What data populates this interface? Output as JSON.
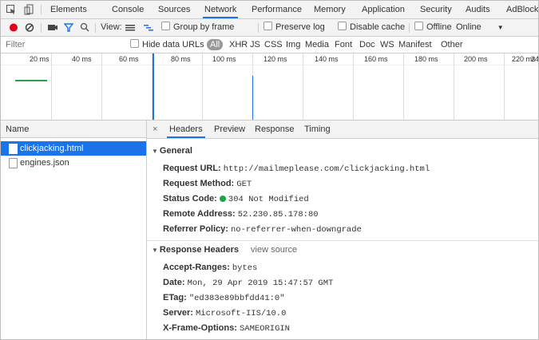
{
  "tabs": [
    "Elements",
    "Console",
    "Sources",
    "Network",
    "Performance",
    "Memory",
    "Application",
    "Security",
    "Audits",
    "AdBlock"
  ],
  "active_tab": "Network",
  "toolbar": {
    "view_label": "View:",
    "group_by_frame": "Group by frame",
    "preserve_log": "Preserve log",
    "disable_cache": "Disable cache",
    "offline": "Offline",
    "throttle_value": "Online"
  },
  "filter": {
    "placeholder": "Filter",
    "hide_data_urls": "Hide data URLs",
    "types": [
      "All",
      "XHR",
      "JS",
      "CSS",
      "Img",
      "Media",
      "Font",
      "Doc",
      "WS",
      "Manifest",
      "Other"
    ]
  },
  "timeline": {
    "ticks": [
      "20 ms",
      "40 ms",
      "60 ms",
      "80 ms",
      "100 ms",
      "120 ms",
      "140 ms",
      "160 ms",
      "180 ms",
      "200 ms",
      "220 ms",
      "24"
    ]
  },
  "requests": {
    "header": "Name",
    "items": [
      "clickjacking.html",
      "engines.json"
    ]
  },
  "detail": {
    "close": "×",
    "tabs": [
      "Headers",
      "Preview",
      "Response",
      "Timing"
    ],
    "general": {
      "title": "General",
      "request_url_label": "Request URL:",
      "request_url": "http://mailmeplease.com/clickjacking.html",
      "request_method_label": "Request Method:",
      "request_method": "GET",
      "status_code_label": "Status Code:",
      "status_code": "304 Not Modified",
      "remote_address_label": "Remote Address:",
      "remote_address": "52.230.85.178:80",
      "referrer_policy_label": "Referrer Policy:",
      "referrer_policy": "no-referrer-when-downgrade"
    },
    "response_headers": {
      "title": "Response Headers",
      "view_source": "view source",
      "accept_ranges_label": "Accept-Ranges:",
      "accept_ranges": "bytes",
      "date_label": "Date:",
      "date": "Mon, 29 Apr 2019 15:47:57 GMT",
      "etag_label": "ETag:",
      "etag": "\"ed383e89bbfdd41:0\"",
      "server_label": "Server:",
      "server": "Microsoft-IIS/10.0",
      "xfo_label": "X-Frame-Options:",
      "xfo": "SAMEORIGIN"
    }
  },
  "colors": {
    "accent": "#1a73e8",
    "record": "#e0001b",
    "status_ok": "#1ea446"
  }
}
